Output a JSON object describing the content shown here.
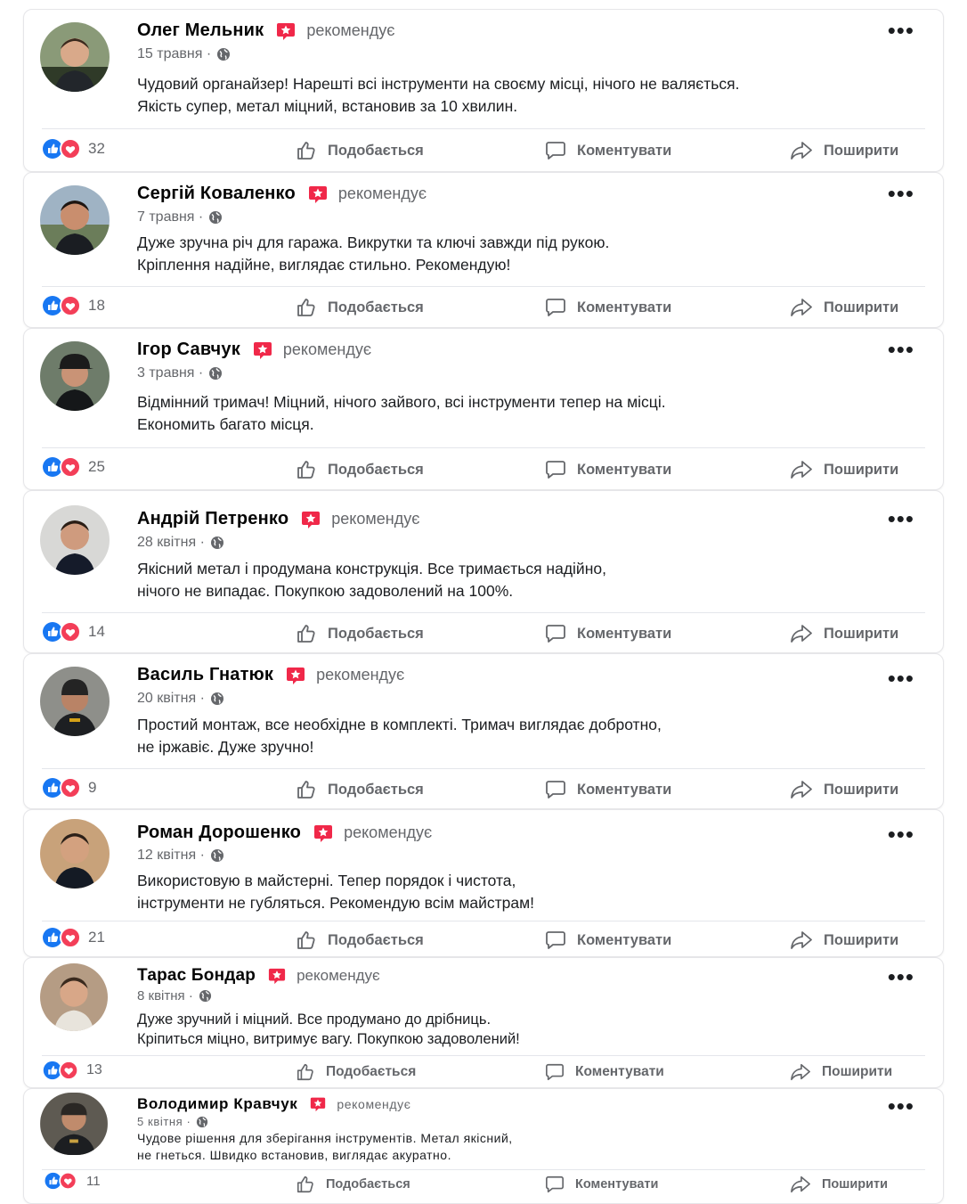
{
  "recommend_label": "рекомендує",
  "actions": {
    "like": "Подобається",
    "comment": "Коментувати",
    "share": "Поширити"
  },
  "colors": {
    "like_blue": "#1877f2",
    "love_red": "#f33e58",
    "recommend_red": "#f02849",
    "muted": "#65676b"
  },
  "reviews": [
    {
      "name": "Олег Мельник",
      "date": "15 травня",
      "lines": [
        "Чудовий органайзер! Нарешті всі інструменти на своєму місці, нічого не валяється.",
        "Якість супер, метал міцний, встановив за 10 хвилин."
      ],
      "reactions": "32"
    },
    {
      "name": "Сергій Коваленко",
      "date": "7 травня",
      "lines": [
        "Дуже зручна річ для гаража. Викрутки та ключі завжди під рукою.",
        "Кріплення надійне, виглядає стильно. Рекомендую!"
      ],
      "reactions": "18"
    },
    {
      "name": "Ігор Савчук",
      "date": "3 травня",
      "lines": [
        "Відмінний тримач! Міцний, нічого зайвого, всі інструменти тепер на місці.",
        "Економить багато місця."
      ],
      "reactions": "25"
    },
    {
      "name": "Андрій Петренко",
      "date": "28 квітня",
      "lines": [
        "Якісний метал і продумана конструкція. Все тримається надійно,",
        "нічого не випадає. Покупкою задоволений на 100%."
      ],
      "reactions": "14"
    },
    {
      "name": "Василь Гнатюк",
      "date": "20 квітня",
      "lines": [
        "Простий монтаж, все необхідне в комплекті. Тримач виглядає добротно,",
        "не іржавіє. Дуже зручно!"
      ],
      "reactions": "9"
    },
    {
      "name": "Роман Дорошенко",
      "date": "12 квітня",
      "lines": [
        "Використовую в майстерні. Тепер порядок і чистота,",
        "інструменти не губляться. Рекомендую всім майстрам!"
      ],
      "reactions": "21"
    },
    {
      "name": "Тарас Бондар",
      "date": "8 квітня",
      "lines": [
        "Дуже зручний і міцний. Все продумано до дрібниць.",
        "Кріпиться міцно, витримує вагу. Покупкою задоволений!"
      ],
      "reactions": "13"
    },
    {
      "name": "Володимир Кравчук",
      "date": "5 квітня",
      "lines": [
        "Чудове рішення для зберігання інструментів. Метал якісний,",
        "не гнеться. Швидко встановив, виглядає акуратно."
      ],
      "reactions": "11"
    }
  ]
}
